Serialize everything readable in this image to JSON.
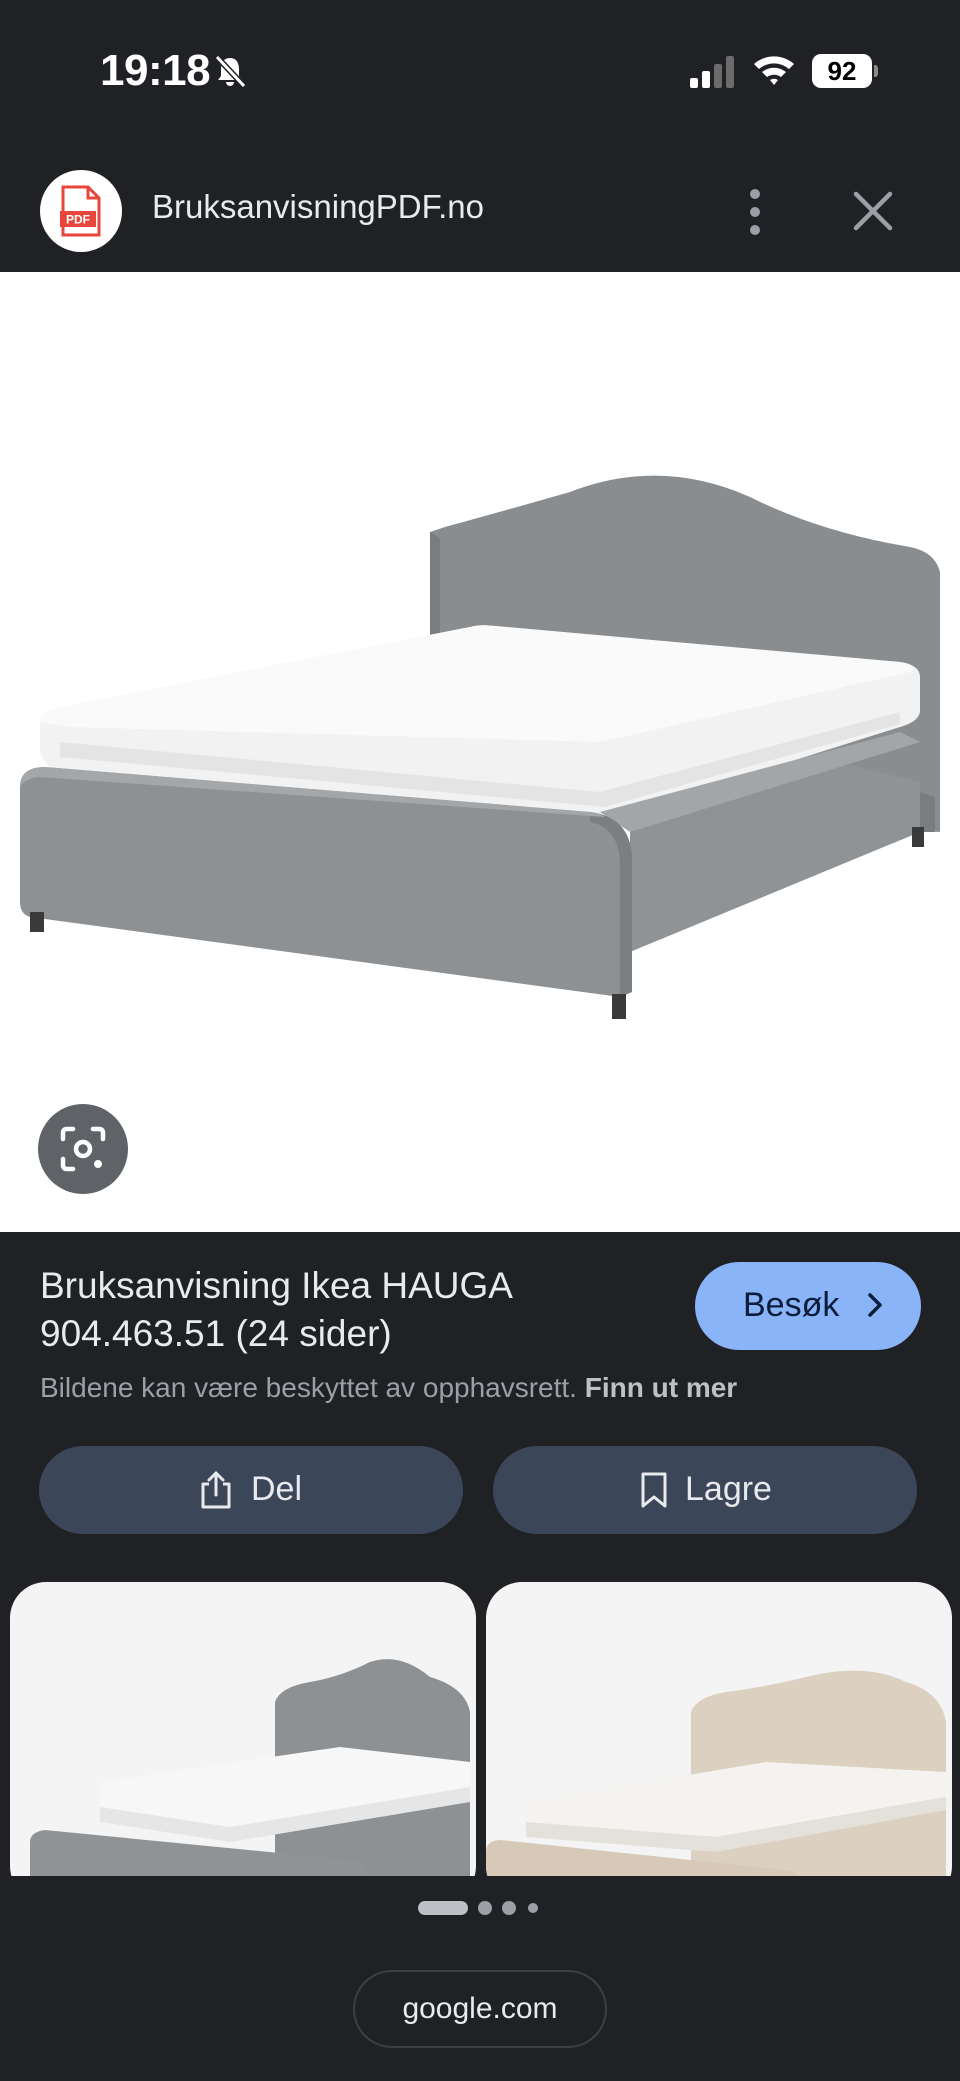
{
  "status_bar": {
    "time": "19:18",
    "battery": "92",
    "icons": [
      "bell-slash-icon",
      "cellular-signal-icon",
      "wifi-icon",
      "battery-icon"
    ]
  },
  "header": {
    "site_name": "BruksanvisningPDF.no",
    "logo_text": "PDF",
    "more_icon": "more-vert-icon",
    "close_icon": "close-icon"
  },
  "main_image": {
    "subject": "grey upholstered double bed with white mattress",
    "lens_icon": "google-lens-icon"
  },
  "result": {
    "title": "Bruksanvisning Ikea HAUGA 904.463.51 (24 sider)",
    "visit_label": "Besøk",
    "disclaimer": "Bildene kan være beskyttet av opphavsrett.",
    "learn_more": "Finn ut mer"
  },
  "actions": {
    "share_label": "Del",
    "save_label": "Lagre"
  },
  "related": {
    "thumbnails": [
      "grey bed",
      "beige bed"
    ]
  },
  "pager": {
    "count": 4,
    "active": 0
  },
  "url_bar": {
    "domain": "google.com"
  },
  "colors": {
    "background": "#202124",
    "accent": "#8ab4f8",
    "button": "#3c4659",
    "logo_red": "#e8453c"
  }
}
